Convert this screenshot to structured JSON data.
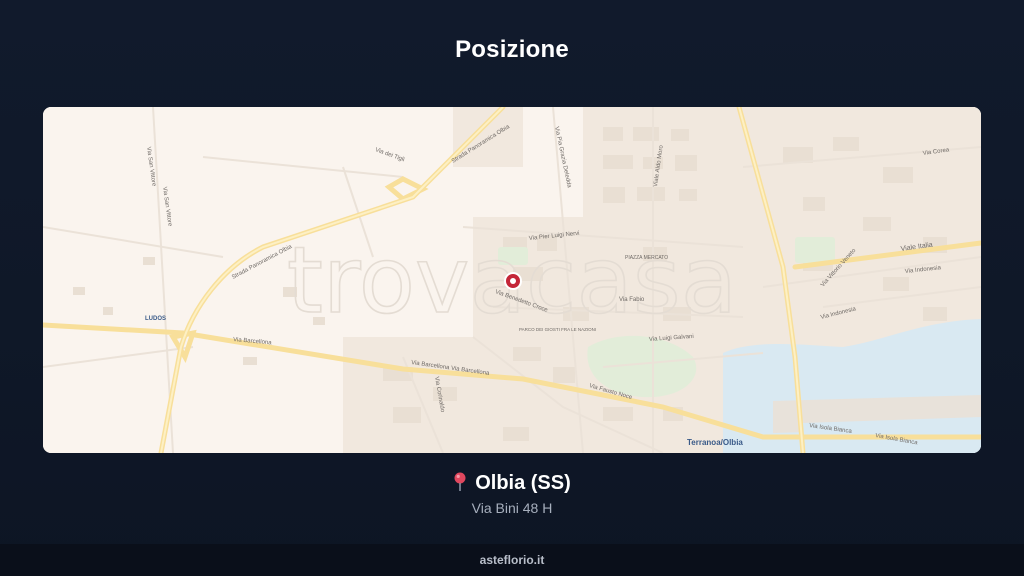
{
  "page": {
    "title": "Posizione"
  },
  "map": {
    "watermark": "trovacasa",
    "labels": {
      "strada_panoramica_1": "Strada Panoramica Olbia",
      "strada_panoramica_2": "Strada Panoramica Olbia",
      "via_dei_tigli": "Via dei Tigli",
      "via_san_vittore": "Via San Vittore",
      "via_san_vittore_2": "Via San Vittore",
      "ludos": "LUDOS",
      "via_barcellona": "Via Barcellona",
      "via_barcellona_2": "Via Barcellona Via Barcellona",
      "via_gramsci": "Via Pia Grazia Deledda",
      "via_aldo_moro": "Viale Aldo Moro",
      "via_pier_luigi_nervi": "Via Pier Luigi Nervi",
      "piazza_mercato": "PIAZZA MERCATO",
      "via_fabio": "Via Fabio",
      "via_benedetto": "Via Benedetto Croce",
      "parco": "PARCO DEI GIOSTI\nFRA LE NAZIONI",
      "via_luigi_galvani": "Via Luigi Galvani",
      "via_fausto_noce": "Via Fausto Noce",
      "via_corea": "Via Corea",
      "viale_italia": "Viale Italia",
      "via_indonesia": "Via Indonesia",
      "via_indonesia_2": "Via Indonesia",
      "via_vittorio_veneto": "Via Vittorio Veneto",
      "terranova": "Terranoa/Olbia",
      "via_isola_bianca": "Via Isola Bianca",
      "via_isola_bianca_2": "Via Isola Bianca",
      "via_corinaldo": "Via Corinaldo"
    },
    "colors": {
      "land": "#faf4ee",
      "block": "#efe6dc",
      "road": "#fbe3a0",
      "water": "#dcebf3",
      "park": "#dfecd6",
      "marker": "#c42638"
    }
  },
  "location": {
    "pin_icon": "pushpin-icon",
    "city": "Olbia (SS)",
    "address": "Via Bini 48 H"
  },
  "footer": {
    "site": "asteflorio.it"
  }
}
